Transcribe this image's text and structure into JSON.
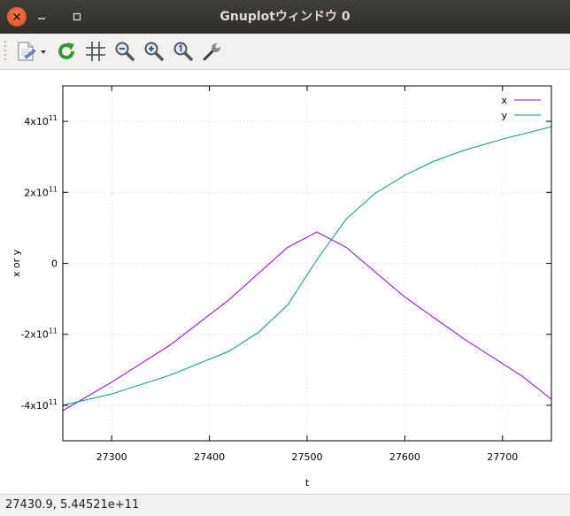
{
  "window": {
    "title": "Gnuplotウィンドウ 0"
  },
  "toolbar": {
    "items": [
      {
        "name": "export-icon"
      },
      {
        "name": "refresh-icon"
      },
      {
        "name": "grid-icon"
      },
      {
        "name": "zoom-out-icon"
      },
      {
        "name": "zoom-in-icon"
      },
      {
        "name": "zoom-reset-icon"
      },
      {
        "name": "settings-icon"
      }
    ]
  },
  "status": {
    "coordinates": "27430.9,  5.44521e+11"
  },
  "chart_data": {
    "type": "line",
    "xlabel": "t",
    "ylabel": "x or y",
    "xlim": [
      27250,
      27750
    ],
    "ylim": [
      -500000000000,
      500000000000
    ],
    "xticks": [
      27300,
      27400,
      27500,
      27600,
      27700
    ],
    "yticks": [
      {
        "value": -400000000000,
        "mant": "-4x10",
        "exp": "11"
      },
      {
        "value": -200000000000,
        "mant": "-2x10",
        "exp": "11"
      },
      {
        "value": 0,
        "mant": "0",
        "exp": ""
      },
      {
        "value": 200000000000,
        "mant": "2x10",
        "exp": "11"
      },
      {
        "value": 400000000000,
        "mant": "4x10",
        "exp": "11"
      }
    ],
    "grid": true,
    "legend_position": "top-right",
    "series": [
      {
        "name": "x",
        "color": "#9400d3",
        "x": [
          27250,
          27300,
          27360,
          27420,
          27480,
          27510,
          27540,
          27600,
          27660,
          27720,
          27750
        ],
        "y": [
          -415000000000,
          -335000000000,
          -230000000000,
          -103000000000,
          45000000000,
          88000000000,
          45000000000,
          -95000000000,
          -212000000000,
          -318000000000,
          -383000000000
        ]
      },
      {
        "name": "y",
        "color": "#009e73",
        "x": [
          27250,
          27300,
          27360,
          27420,
          27450,
          27480,
          27510,
          27540,
          27570,
          27600,
          27630,
          27660,
          27700,
          27750
        ],
        "y": [
          -400000000000,
          -368000000000,
          -315000000000,
          -248000000000,
          -195000000000,
          -118000000000,
          10000000000,
          125000000000,
          198000000000,
          248000000000,
          288000000000,
          318000000000,
          350000000000,
          385000000000
        ]
      }
    ]
  }
}
